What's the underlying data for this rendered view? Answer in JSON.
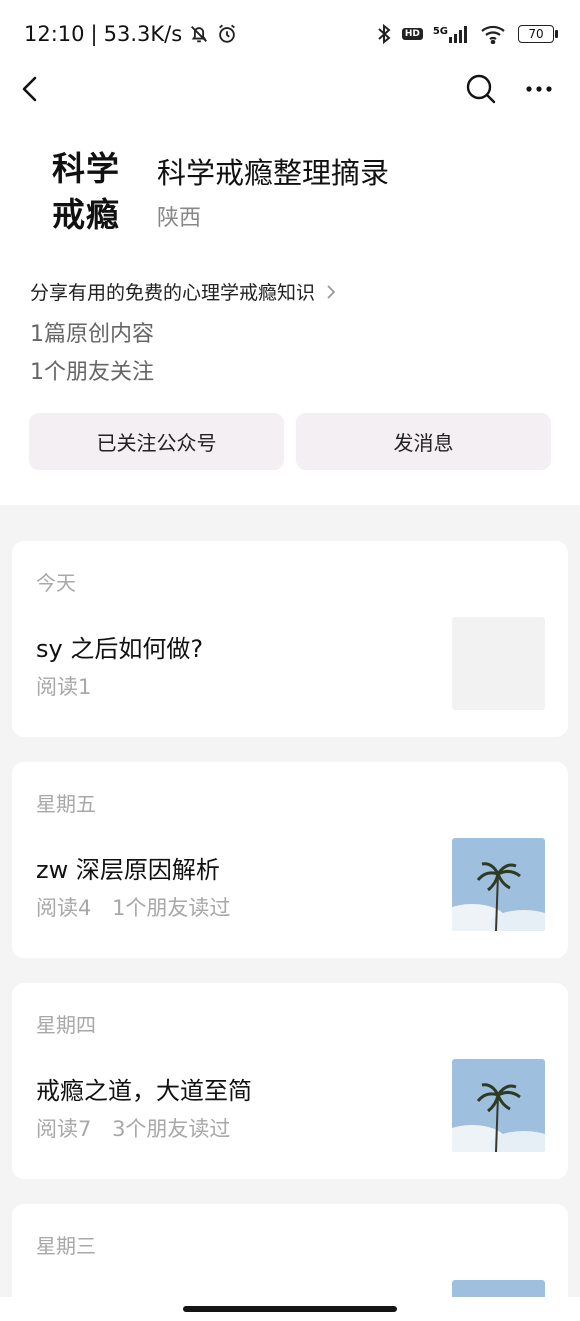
{
  "status_bar": {
    "time": "12:10",
    "separator": "|",
    "network_speed": "53.3K/s",
    "hd_label": "HD",
    "signal_label": "5G",
    "battery": "70",
    "icons": [
      "bell-off-icon",
      "alarm-icon",
      "bluetooth-icon",
      "hd-icon",
      "signal-icon",
      "wifi-icon",
      "battery-icon"
    ]
  },
  "nav": {
    "icons": [
      "back-icon",
      "search-icon",
      "more-icon"
    ]
  },
  "profile": {
    "logo_line1": "科学",
    "logo_line2": "戒瘾",
    "name": "科学戒瘾整理摘录",
    "region": "陕西",
    "description": "分享有用的免费的心理学戒瘾知识",
    "original_count": "1篇原创内容",
    "friends_follow": "1个朋友关注",
    "follow_button": "已关注公众号",
    "message_button": "发消息"
  },
  "articles": [
    {
      "day": "今天",
      "title": "sy 之后如何做?",
      "reads": "阅读1",
      "friends": "",
      "thumb": "blank"
    },
    {
      "day": "星期五",
      "title": "zw 深层原因解析",
      "reads": "阅读4",
      "friends": "1个朋友读过",
      "thumb": "palm"
    },
    {
      "day": "星期四",
      "title": "戒瘾之道，大道至简",
      "reads": "阅读7",
      "friends": "3个朋友读过",
      "thumb": "palm"
    },
    {
      "day": "星期三",
      "title": "",
      "reads": "",
      "friends": "",
      "thumb": "palm"
    }
  ],
  "colors": {
    "background": "#f5f4f5",
    "card": "#ffffff",
    "button_bg": "#f3eff3",
    "meta_text": "#a8a8a8"
  }
}
